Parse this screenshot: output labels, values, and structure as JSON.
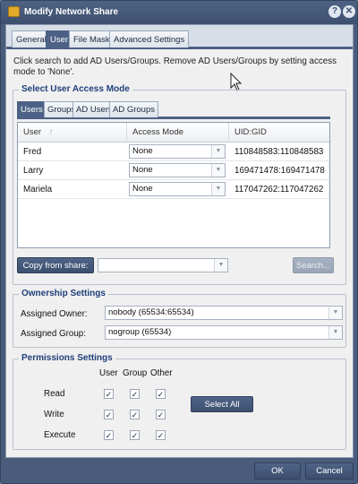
{
  "window": {
    "title": "Modify Network Share",
    "help_icon": "?",
    "close_icon": "✕"
  },
  "tabs": [
    "General",
    "User",
    "File Masks",
    "Advanced Settings"
  ],
  "active_tab": "User",
  "help_text": "Click search to add AD Users/Groups. Remove AD Users/Groups by setting access mode to 'None'.",
  "user_access": {
    "legend": "Select User Access Mode",
    "tabs": [
      "Users",
      "Groups",
      "AD Users",
      "AD Groups"
    ],
    "active_tab": "Users",
    "columns": [
      "User",
      "Access Mode",
      "UID:GID"
    ],
    "sort_indicator": "↑",
    "rows": [
      {
        "user": "Fred",
        "access_mode": "None",
        "uid_gid": "110848583:110848583"
      },
      {
        "user": "Larry",
        "access_mode": "None",
        "uid_gid": "169471478:169471478"
      },
      {
        "user": "Mariela",
        "access_mode": "None",
        "uid_gid": "117047262:117047262"
      }
    ],
    "copy_button": "Copy from share:",
    "copy_value": "",
    "search_button": "Search..."
  },
  "ownership": {
    "legend": "Ownership Settings",
    "owner_label": "Assigned Owner:",
    "owner_value": "nobody (65534:65534)",
    "group_label": "Assigned Group:",
    "group_value": "nogroup (65534)"
  },
  "permissions": {
    "legend": "Permissions Settings",
    "columns": [
      "User",
      "Group",
      "Other"
    ],
    "rows": [
      {
        "label": "Read",
        "checks": [
          true,
          true,
          true
        ]
      },
      {
        "label": "Write",
        "checks": [
          true,
          true,
          true
        ]
      },
      {
        "label": "Execute",
        "checks": [
          true,
          true,
          true
        ]
      }
    ],
    "select_all_button": "Select All",
    "check_glyph": "✓"
  },
  "footer": {
    "ok_button": "OK",
    "cancel_button": "Cancel"
  },
  "colors": {
    "titlebar": "#3d4f6e",
    "accent": "#4c6185",
    "legend_text": "#1f3f7a"
  }
}
